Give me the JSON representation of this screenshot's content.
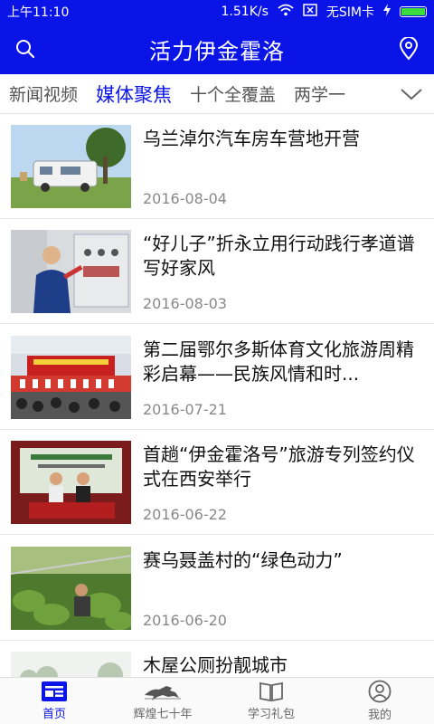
{
  "status_bar": {
    "time": "上午11:10",
    "net_speed": "1.51K/s",
    "sim": "无SIM卡"
  },
  "app_bar": {
    "title": "活力伊金霍洛"
  },
  "tabs": [
    {
      "label": "新闻视频"
    },
    {
      "label": "媒体聚焦"
    },
    {
      "label": "十个全覆盖"
    },
    {
      "label": "两学一"
    }
  ],
  "news": [
    {
      "title": "乌兰淖尔汽车房车营地开营",
      "date": "2016-08-04",
      "thumb": "campervan-photo"
    },
    {
      "title": "“好儿子”折永立用行动践行孝道谱写好家风",
      "date": "2016-08-03",
      "thumb": "electrician-photo"
    },
    {
      "title": "第二届鄂尔多斯体育文化旅游周精彩启幕——民族风情和时...",
      "date": "2016-07-21",
      "thumb": "ceremony-photo"
    },
    {
      "title": "首趟“伊金霍洛号”旅游专列签约仪式在西安举行",
      "date": "2016-06-22",
      "thumb": "signing-photo"
    },
    {
      "title": "赛乌聂盖村的“绿色动力”",
      "date": "2016-06-20",
      "thumb": "greenhouse-photo"
    },
    {
      "title": "木屋公厕扮靓城市",
      "date": "",
      "thumb": "cabin-photo"
    }
  ],
  "bottom_nav": [
    {
      "label": "首页",
      "icon": "news-icon"
    },
    {
      "label": "辉煌七十年",
      "icon": "horse-icon"
    },
    {
      "label": "学习礼包",
      "icon": "book-icon"
    },
    {
      "label": "我的",
      "icon": "profile-icon"
    }
  ],
  "colors": {
    "brand_blue": "#0a14e6",
    "active_tab": "#0a14e6",
    "date_gray": "#888888"
  }
}
